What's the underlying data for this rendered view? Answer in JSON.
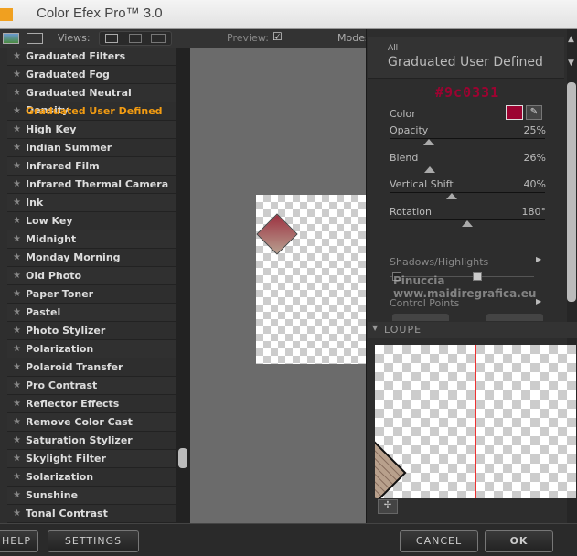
{
  "app": {
    "title": "Color Efex Pro™ 3.0"
  },
  "toolbar": {
    "views_label": "Views:",
    "preview_label": "Preview:",
    "preview_checked": true,
    "modes_label": "Modes"
  },
  "filters": [
    "Graduated Filters",
    "Graduated Fog",
    "Graduated Neutral Density",
    "Graduated User Defined",
    "High Key",
    "Indian Summer",
    "Infrared Film",
    "Infrared Thermal Camera",
    "Ink",
    "Low Key",
    "Midnight",
    "Monday Morning",
    "Old Photo",
    "Paper Toner",
    "Pastel",
    "Photo Stylizer",
    "Polarization",
    "Polaroid Transfer",
    "Pro Contrast",
    "Reflector Effects",
    "Remove Color Cast",
    "Saturation Stylizer",
    "Skylight Filter",
    "Solarization",
    "Sunshine",
    "Tonal Contrast"
  ],
  "active_filter_index": 3,
  "panel": {
    "category": "All",
    "filter_name": "Graduated User Defined",
    "color_hex_annotation": "#9c0331",
    "color_label": "Color",
    "color_value": "#9c0331",
    "sliders": [
      {
        "label": "Opacity",
        "value": "25%",
        "fraction": 0.25
      },
      {
        "label": "Blend",
        "value": "26%",
        "fraction": 0.26
      },
      {
        "label": "Vertical Shift",
        "value": "40%",
        "fraction": 0.4
      },
      {
        "label": "Rotation",
        "value": "180°",
        "fraction": 0.5
      }
    ],
    "shadows_highlights": "Shadows/Highlights",
    "control_points": "Control Points",
    "watermark": "Pinuccia www.maidiregrafica.eu"
  },
  "loupe": {
    "label": "LOUPE"
  },
  "buttons": {
    "help": "HELP",
    "settings": "SETTINGS",
    "cancel": "CANCEL",
    "ok": "OK"
  }
}
